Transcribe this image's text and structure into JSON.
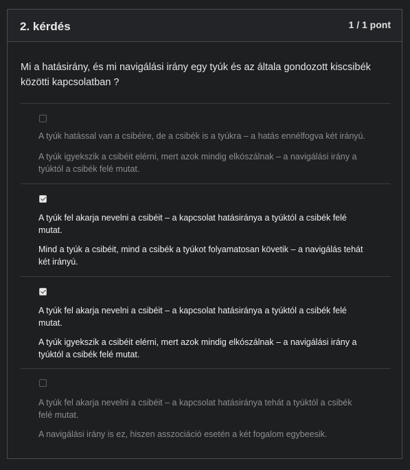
{
  "question": {
    "number_label": "2. kérdés",
    "points": "1 / 1 pont",
    "text": "Mi a hatásirány, és mi navigálási irány egy tyúk és az általa gondozott kiscsibék közötti kapcsolatban ?"
  },
  "options": [
    {
      "checked": false,
      "line1": "A tyúk hatással van a csibéire, de a csibék is a tyúkra – a hatás ennélfogva két irányú.",
      "line2": "A tyúk igyekszik a csibéit elérni, mert azok mindig elkószálnak – a navigálási irány a tyúktól a csibék felé mutat."
    },
    {
      "checked": true,
      "line1": "A tyúk fel akarja nevelni a csibéit – a kapcsolat hatásiránya a tyúktól a csibék felé mutat.",
      "line2": "Mind a tyúk a csibéit, mind a csibék a tyúkot folyamatosan követik – a navigálás tehát két irányú."
    },
    {
      "checked": true,
      "line1": "A tyúk fel akarja nevelni a csibéit – a kapcsolat hatásiránya a tyúktól a csibék felé mutat.",
      "line2": "A tyúk igyekszik a csibéit elérni, mert azok mindig elkószálnak – a navigálási irány a tyúktól a csibék felé mutat."
    },
    {
      "checked": false,
      "line1": "A tyúk fel akarja nevelni a csibéit – a kapcsolat hatásiránya tehát a tyúktól a csibék felé mutat.",
      "line2": "A navigálási irány is ez, hiszen asszociáció esetén a két fogalom egybeesik."
    }
  ]
}
